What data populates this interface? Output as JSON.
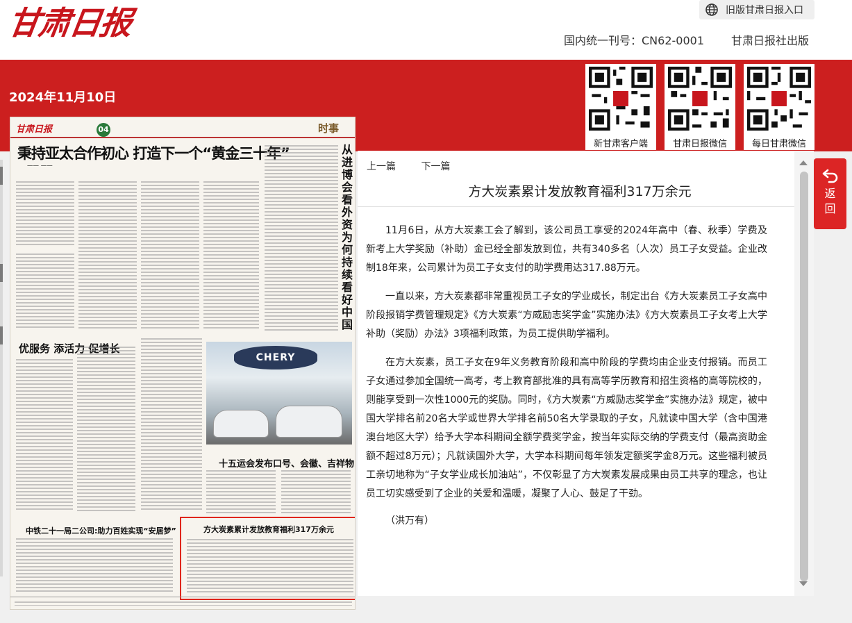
{
  "header": {
    "logo_text": "甘肃日报",
    "old_version_link": "旧版甘肃日报入口",
    "issn": "国内统一刊号：CN62-0001",
    "publisher": "甘肃日报社出版"
  },
  "date": "2024年11月10日",
  "qr_codes": [
    {
      "caption": "新甘肃客户端"
    },
    {
      "caption": "甘肃日报微信"
    },
    {
      "caption": "每日甘肃微信"
    }
  ],
  "back_button": {
    "label": "返回"
  },
  "newspaper": {
    "page_number": "04",
    "section": "时事",
    "headline": "秉持亚太合作初心 打造下一个“黄金三十年”",
    "vertical_headline": "从进博会看外资为何持续看好中国",
    "feature_left": "优服务 添活力 促增长",
    "feature_right": "十五运会发布口号、会徽、吉祥物",
    "bottom_left": "中铁二十一局二公司:助力百姓实现“安居梦”",
    "highlight_title": "方大炭素累计发放教育福利317万余元",
    "photo_banner": "CHERY"
  },
  "article": {
    "nav_prev": "上一篇",
    "nav_next": "下一篇",
    "title": "方大炭素累计发放教育福利317万余元",
    "paragraphs": [
      "11月6日，从方大炭素工会了解到，该公司员工享受的2024年高中（春、秋季）学费及新考上大学奖励（补助）金已经全部发放到位，共有340多名（人次）员工子女受益。企业改制18年来，公司累计为员工子女支付的助学费用达317.88万元。",
      "一直以来，方大炭素都非常重视员工子女的学业成长，制定出台《方大炭素员工子女高中阶段报销学费管理规定》《方大炭素“方威励志奖学金”实施办法》《方大炭素员工子女考上大学补助（奖励）办法》3项福利政策，为员工提供助学福利。",
      "在方大炭素，员工子女在9年义务教育阶段和高中阶段的学费均由企业支付报销。而员工子女通过参加全国统一高考，考上教育部批准的具有高等学历教育和招生资格的高等院校的，则能享受到一次性1000元的奖励。同时，《方大炭素“方威励志奖学金”实施办法》规定，被中国大学排名前20名大学或世界大学排名前50名大学录取的子女，凡就读中国大学（含中国港澳台地区大学）给予大学本科期间全额学费奖学金，按当年实际交纳的学费支付（最高资助金额不超过8万元）；凡就读国外大学，大学本科期间每年领发定额奖学金8万元。这些福利被员工亲切地称为“子女学业成长加油站”，不仅彰显了方大炭素发展成果由员工共享的理念，也让员工切实感受到了企业的关爱和温暖，凝聚了人心、鼓足了干劲。"
    ],
    "author": "（洪万有）"
  },
  "colors": {
    "brand_red": "#cc1f1f",
    "button_red": "#dc2525",
    "highlight_border": "#e0261c"
  }
}
